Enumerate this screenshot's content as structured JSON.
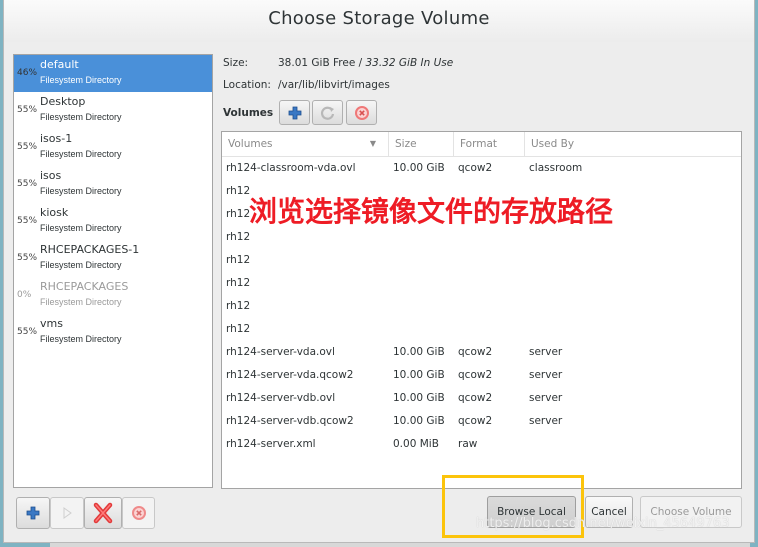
{
  "window": {
    "title": "Choose Storage Volume"
  },
  "pools": [
    {
      "percent": "46%",
      "name": "default",
      "type": "Filesystem Directory",
      "selected": true,
      "active": true
    },
    {
      "percent": "55%",
      "name": "Desktop",
      "type": "Filesystem Directory",
      "selected": false,
      "active": true
    },
    {
      "percent": "55%",
      "name": "isos-1",
      "type": "Filesystem Directory",
      "selected": false,
      "active": true
    },
    {
      "percent": "55%",
      "name": "isos",
      "type": "Filesystem Directory",
      "selected": false,
      "active": true
    },
    {
      "percent": "55%",
      "name": "kiosk",
      "type": "Filesystem Directory",
      "selected": false,
      "active": true
    },
    {
      "percent": "55%",
      "name": "RHCEPACKAGES-1",
      "type": "Filesystem Directory",
      "selected": false,
      "active": true
    },
    {
      "percent": "0%",
      "name": "RHCEPACKAGES",
      "type": "Filesystem Directory",
      "selected": false,
      "active": false
    },
    {
      "percent": "55%",
      "name": "vms",
      "type": "Filesystem Directory",
      "selected": false,
      "active": true
    }
  ],
  "pool_info": {
    "size_label": "Size:",
    "size_free": "38.01 GiB Free / ",
    "size_inuse": "33.32 GiB In Use",
    "location_label": "Location:",
    "location_value": "/var/lib/libvirt/images",
    "volumes_label": "Volumes"
  },
  "volume_toolbar": {
    "add_icon": "plus-icon",
    "refresh_icon": "refresh-icon",
    "delete_icon": "stop-delete-icon"
  },
  "volumes_table": {
    "columns": [
      "Volumes",
      "Size",
      "Format",
      "Used By"
    ],
    "rows": [
      [
        "rh124-classroom-vda.ovl",
        "10.00 GiB",
        "qcow2",
        "classroom"
      ],
      [
        "rh12",
        "",
        "",
        ""
      ],
      [
        "rh12",
        "",
        "",
        ""
      ],
      [
        "rh12",
        "",
        "",
        ""
      ],
      [
        "rh12",
        "",
        "",
        ""
      ],
      [
        "rh12",
        "",
        "",
        ""
      ],
      [
        "rh12",
        "",
        "",
        ""
      ],
      [
        "rh12",
        "",
        "",
        ""
      ],
      [
        "rh124-server-vda.ovl",
        "10.00 GiB",
        "qcow2",
        "server"
      ],
      [
        "rh124-server-vda.qcow2",
        "10.00 GiB",
        "qcow2",
        "server"
      ],
      [
        "rh124-server-vdb.ovl",
        "10.00 GiB",
        "qcow2",
        "server"
      ],
      [
        "rh124-server-vdb.qcow2",
        "10.00 GiB",
        "qcow2",
        "server"
      ],
      [
        "rh124-server.xml",
        "0.00 MiB",
        "raw",
        ""
      ]
    ]
  },
  "annotation": {
    "text": "浏览选择镜像文件的存放路径",
    "color": "#ee1c25",
    "box_color": "#fcc40b"
  },
  "pool_toolbar": {
    "add_icon": "plus-icon",
    "start_icon": "play-icon",
    "delete_icon": "red-x-icon",
    "stop_icon": "stop-icon"
  },
  "buttons": {
    "browse_local": "Browse Local",
    "cancel": "Cancel",
    "choose_volume": "Choose Volume"
  },
  "watermark": "https://blog.csdn.net/weixin_45649763"
}
